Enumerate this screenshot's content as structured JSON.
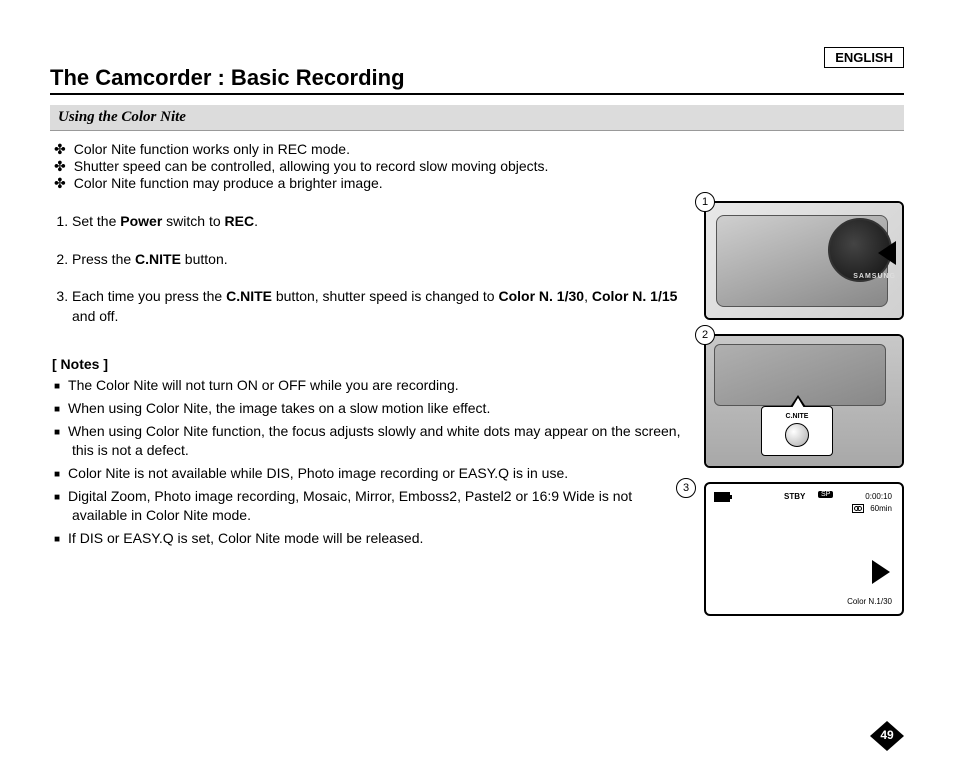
{
  "language_label": "ENGLISH",
  "main_title": "The Camcorder : Basic Recording",
  "section_title": "Using the Color Nite",
  "intro_bullets": [
    "Color Nite function works only in REC mode.",
    "Shutter speed can be controlled, allowing you to record slow moving objects.",
    "Color Nite function may produce a brighter image."
  ],
  "steps": {
    "s1_pre": "Set the ",
    "s1_b1": "Power",
    "s1_mid": " switch to ",
    "s1_b2": "REC",
    "s1_post": ".",
    "s2_pre": "Press the ",
    "s2_b1": "C.NITE",
    "s2_post": " button.",
    "s3_pre": "Each time you press the ",
    "s3_b1": "C.NITE",
    "s3_mid": " button, shutter speed is changed to ",
    "s3_b2": "Color N. 1/30",
    "s3_mid2": ", ",
    "s3_b3": "Color N. 1/15",
    "s3_post": " and off."
  },
  "notes_title": "[ Notes ]",
  "notes": [
    "The Color Nite will not turn ON or OFF while you are recording.",
    "When using Color Nite, the image takes on a slow motion like effect.",
    "When using Color Nite function, the focus adjusts slowly and white dots may appear on the screen, this is not a defect.",
    "Color Nite is not available while DIS, Photo image recording or EASY.Q is in use.",
    "Digital Zoom, Photo image recording, Mosaic, Mirror, Emboss2, Pastel2 or 16:9 Wide is not available in Color Nite mode.",
    "If DIS or EASY.Q is set, Color Nite mode will be released."
  ],
  "figures": {
    "num1": "1",
    "num2": "2",
    "num3": "3",
    "fig1_brand": "SAMSUNG",
    "fig2_button_label": "C.NITE",
    "osd": {
      "stby": "STBY",
      "sp": "SP",
      "time": "0:00:10",
      "remaining": "60min",
      "color_mode": "Color N.1/30"
    }
  },
  "page_number": "49"
}
